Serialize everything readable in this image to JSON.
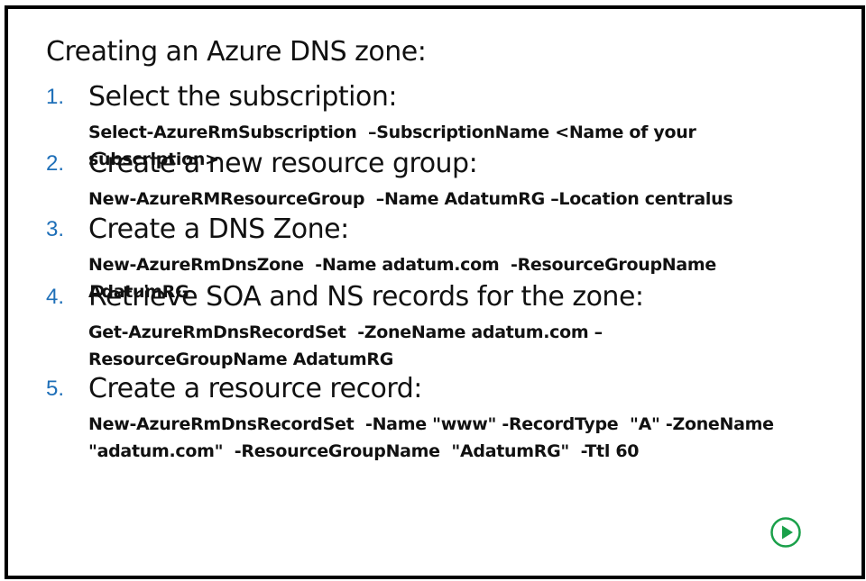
{
  "slide": {
    "title": "Creating an Azure DNS zone:",
    "steps": [
      {
        "number": "1.",
        "label": "Select the subscription:",
        "command": "Select-AzureRmSubscription  –SubscriptionName <Name of your subscription>"
      },
      {
        "number": "2.",
        "label": "Create a new resource group:",
        "command": "New-AzureRMResourceGroup  –Name AdatumRG –Location centralus"
      },
      {
        "number": "3.",
        "label": "Create a DNS Zone:",
        "command": "New-AzureRmDnsZone  -Name adatum.com  -ResourceGroupName  AdatumRG"
      },
      {
        "number": "4.",
        "label": "Retrieve SOA and NS records for the zone:",
        "command": "Get-AzureRmDnsRecordSet  -ZoneName adatum.com –ResourceGroupName AdatumRG"
      },
      {
        "number": "5.",
        "label": "Create a resource record:",
        "command": "New-AzureRmDnsRecordSet  -Name \"www\" -RecordType  \"A\" -ZoneName \"adatum.com\"  -ResourceGroupName  \"AdatumRG\"  -Ttl 60"
      }
    ]
  },
  "colors": {
    "number": "#1e6fb8",
    "text": "#111111",
    "play_button": "#1aa04a",
    "border": "#000000"
  },
  "icons": {
    "play": "play-circle-icon"
  }
}
